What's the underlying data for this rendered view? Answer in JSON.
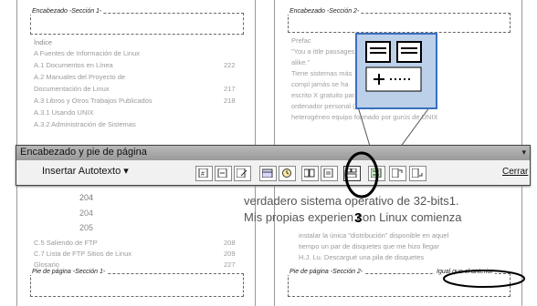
{
  "left_page": {
    "header_label": "Encabezado -Sección 1-",
    "footer_label": "Pie de página -Sección 1-",
    "index_title": "Índice",
    "toc": [
      {
        "text": "A Fuentes de Información de Linux",
        "page": ""
      },
      {
        "text": "A.1 Documentos en Línea",
        "page": "222"
      },
      {
        "text": "A.2   Manuales   del   Proyecto   de",
        "page": ""
      },
      {
        "text": "Documentación de Linux",
        "page": "217"
      },
      {
        "text": "A.3 Libros y Otros Trabajos Publicados",
        "page": "218"
      },
      {
        "text": "A.3.1 Usando UNIX",
        "page": ""
      },
      {
        "text": "A.3.2 Administración de Sistemas",
        "page": ""
      }
    ],
    "toc_bottom": [
      {
        "text": "C.5 Saliendo de FTP",
        "page": "208"
      },
      {
        "text": "C.7 Lista de FTP Sitios de Linux",
        "page": "209"
      },
      {
        "text": "Glosario",
        "page": "227"
      }
    ],
    "page_numbers": [
      "204",
      "204",
      "205"
    ]
  },
  "right_page": {
    "header_label": "Encabezado -Sección 2-",
    "footer_label": "Pie de página -Sección 2-",
    "footer_link": "Igual que el anterior",
    "body_lines": [
      "Prefac",
      "\"You a                           ittle passages, all",
      "alike.\"",
      "Tiene                            sistemas más",
      "compl                            jamás se ha",
      "escrito                          X gratuito para el",
      "ordenador  personal  (PC),  generado  por  un",
      "heterogéneo  equipo  formado  por  gurús  de  UNIX"
    ],
    "large_lines": [
      "verdadero sistema operativo de 32-bits1.",
      "Mis  propias  experien       con  Linux  comienza"
    ],
    "bottom_lines": [
      "instalar la única \"distribución\" disponible en aquel",
      "tiempo un par de disquetes que me hizo llegar",
      "H.J. Lu. Descargué una pila de disquetes"
    ]
  },
  "toolbar": {
    "title": "Encabezado y pie de página",
    "insert_autotext": "Insertar Autotexto ▾",
    "close_label": "Cerrar"
  },
  "annotation": {
    "number": "3"
  },
  "colors": {
    "toolbar_title": "#a8a8a8",
    "zoom_border": "#3a6fc0",
    "zoom_bg": "#bcd0ea"
  }
}
